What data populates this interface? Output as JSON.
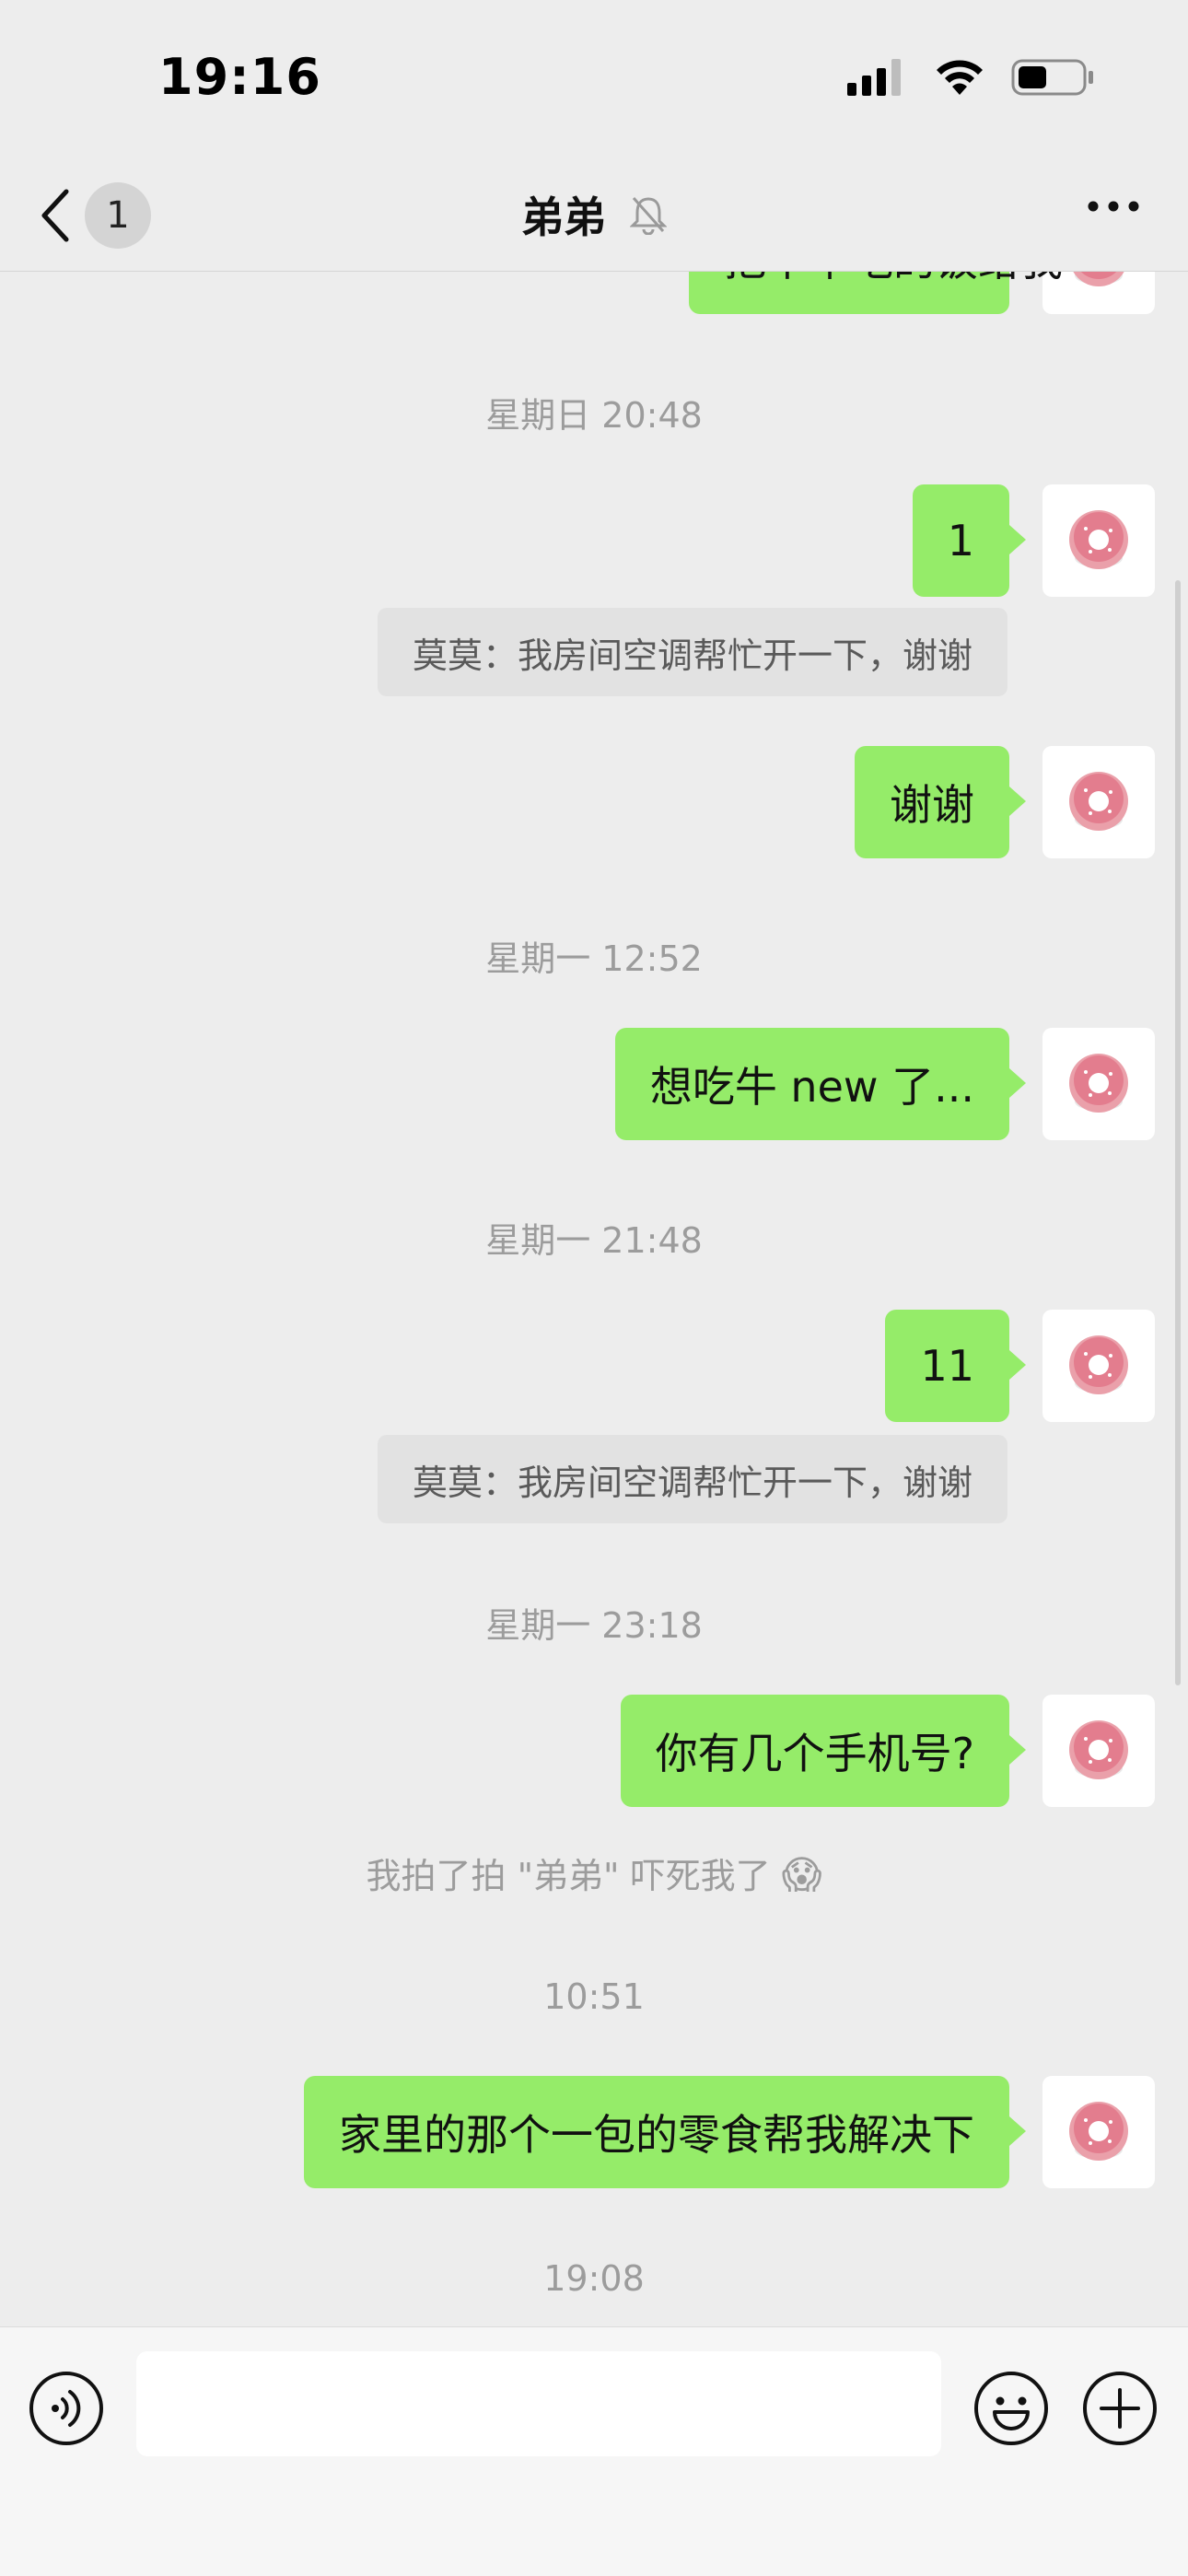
{
  "status_bar": {
    "time": "19:16",
    "icons": [
      "signal-icon",
      "wifi-icon",
      "battery-icon"
    ]
  },
  "nav": {
    "back_badge": "1",
    "title": "弟弟",
    "icons": [
      "back-chevron-icon",
      "mute-bell-icon",
      "more-icon"
    ]
  },
  "messages": {
    "m0": {
      "text": "把中午吃的饭给我"
    },
    "t1": "星期日 20:48",
    "m1": {
      "text": "1"
    },
    "q1": "莫莫：我房间空调帮忙开一下，谢谢",
    "m2": {
      "text": "谢谢"
    },
    "t2": "星期一 12:52",
    "m3": {
      "text": "想吃牛 new 了..."
    },
    "t3": "星期一 21:48",
    "m4": {
      "text": "11"
    },
    "q2": "莫莫：我房间空调帮忙开一下，谢谢",
    "t4": "星期一 23:18",
    "m5": {
      "text": "你有几个手机号?"
    },
    "sys1": "我拍了拍 \"弟弟\" 吓死我了",
    "sys1_emoji": "😱",
    "t5": "10:51",
    "m6": {
      "text": "家里的那个一包的零食帮我解决下"
    },
    "t6": "19:08"
  },
  "input_bar": {
    "value": "",
    "placeholder": "",
    "icons": [
      "voice-icon",
      "emoji-icon",
      "plus-icon"
    ]
  },
  "colors": {
    "background": "#ededed",
    "bubble_sent": "#95ec69",
    "quote_bg": "#e2e2e2",
    "timestamp_text": "#9c9c9c",
    "avatar_donut": "#e98a98"
  }
}
